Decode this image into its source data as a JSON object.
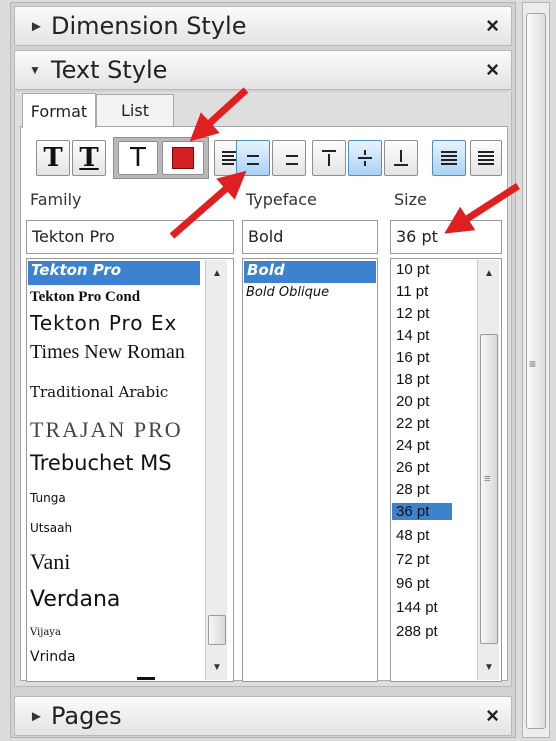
{
  "sections": {
    "dimension_style": {
      "title": "Dimension Style",
      "expander": "►",
      "close": "×"
    },
    "text_style": {
      "title": "Text Style",
      "expander": "▼",
      "close": "×"
    },
    "pages": {
      "title": "Pages",
      "expander": "►",
      "close": "×"
    }
  },
  "tabs": [
    {
      "label": "Format"
    },
    {
      "label": "List"
    }
  ],
  "toolbar": {
    "tt_a": "T",
    "tt_b": "T",
    "tt_c": "T",
    "text_color": "#d42020"
  },
  "labels": {
    "family": "Family",
    "typeface": "Typeface",
    "size": "Size"
  },
  "fields": {
    "family": "Tekton Pro",
    "typeface": "Bold",
    "size": "36 pt"
  },
  "family_list": [
    "Tekton Pro",
    "Tekton Pro Cond",
    "Tekton Pro Ex",
    "Times New Roman",
    "Traditional Arabic",
    "TRAJAN PRO",
    "Trebuchet MS",
    "Tunga",
    "Utsaah",
    "Vani",
    "Verdana",
    "Vijaya",
    "Vrinda"
  ],
  "typeface_list": [
    "Bold",
    "Bold Oblique"
  ],
  "size_list": [
    "10 pt",
    "11 pt",
    "12 pt",
    "14 pt",
    "16 pt",
    "18 pt",
    "20 pt",
    "22 pt",
    "24 pt",
    "26 pt",
    "28 pt",
    "36 pt",
    "48 pt",
    "72 pt",
    "96 pt",
    "144 pt",
    "288 pt"
  ],
  "scroll": {
    "up": "▲",
    "down": "▼",
    "grip": "≡"
  },
  "colors": {
    "selection": "#3d82cf",
    "annotation_arrow": "#e02020"
  }
}
